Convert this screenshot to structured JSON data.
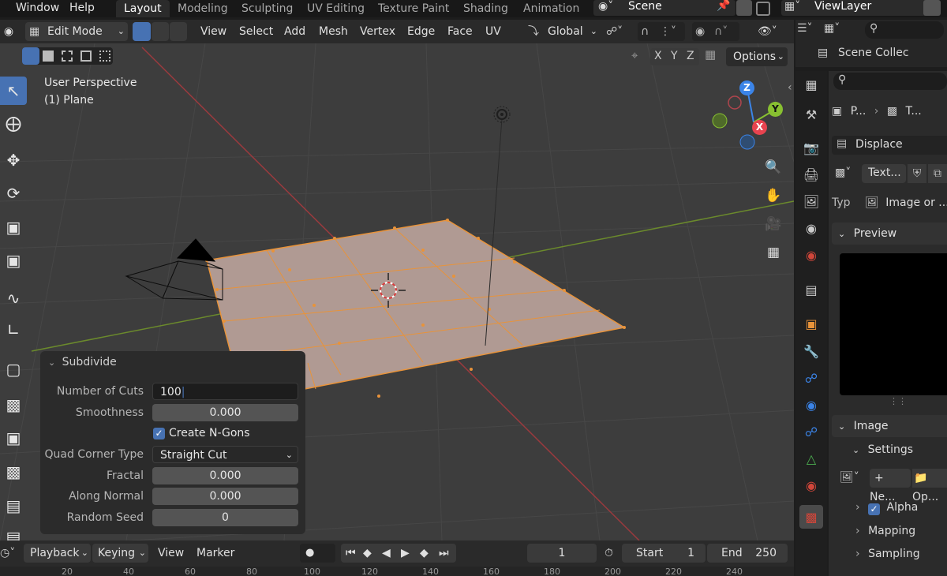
{
  "menu": {
    "window": "Window",
    "help": "Help"
  },
  "workspaces": [
    "Layout",
    "Modeling",
    "Sculpting",
    "UV Editing",
    "Texture Paint",
    "Shading",
    "Animation"
  ],
  "scene": {
    "label": "Scene",
    "view_layer": "ViewLayer"
  },
  "header": {
    "mode": "Edit Mode",
    "menus": [
      "View",
      "Select",
      "Add",
      "Mesh",
      "Vertex",
      "Edge",
      "Face",
      "UV"
    ],
    "orientation": "Global",
    "options": "Options",
    "axes": [
      "X",
      "Y",
      "Z"
    ]
  },
  "viewport": {
    "perspective": "User Perspective",
    "object": "(1) Plane",
    "gizmo": {
      "z": "Z",
      "y": "Y",
      "x": "X"
    }
  },
  "subdivide": {
    "title": "Subdivide",
    "number_of_cuts_label": "Number of Cuts",
    "number_of_cuts": "100",
    "smoothness_label": "Smoothness",
    "smoothness": "0.000",
    "create_ngons_label": "Create N-Gons",
    "create_ngons": true,
    "quad_corner_label": "Quad Corner Type",
    "quad_corner": "Straight Cut",
    "fractal_label": "Fractal",
    "fractal": "0.000",
    "along_normal_label": "Along Normal",
    "along_normal": "0.000",
    "random_seed_label": "Random Seed",
    "random_seed": "0"
  },
  "timeline": {
    "playback": "Playback",
    "keying": "Keying",
    "view": "View",
    "marker": "Marker",
    "current_frame": "1",
    "start_label": "Start",
    "start": "1",
    "end_label": "End",
    "end": "250",
    "ruler": [
      "20",
      "40",
      "60",
      "80",
      "100",
      "120",
      "140",
      "160",
      "180",
      "200",
      "220",
      "240"
    ]
  },
  "outliner": {
    "scene_collection": "Scene Collec"
  },
  "properties": {
    "breadcrumb_object": "P...",
    "breadcrumb_texture": "T...",
    "modifier": "Displace",
    "texture_name": "Text...",
    "type_label": "Typ",
    "type_value": "Image or ...",
    "preview_label": "Preview",
    "image_label": "Image",
    "settings_label": "Settings",
    "new_label": "Ne...",
    "open_label": "Op...",
    "alpha_label": "Alpha",
    "mapping_label": "Mapping",
    "sampling_label": "Sampling"
  },
  "colors": {
    "accent": "#4772b3",
    "selection_orange": "#e8933a",
    "axis_x": "#e8434f",
    "axis_y": "#88c031",
    "axis_z": "#3b84e8"
  }
}
